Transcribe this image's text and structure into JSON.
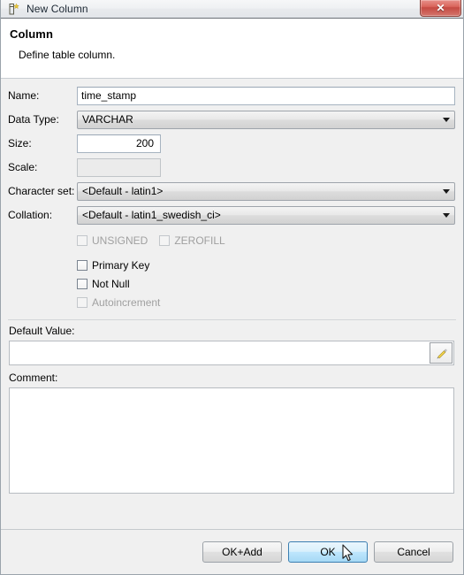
{
  "window": {
    "title": "New Column",
    "title_icon": "new-column-icon",
    "close_label": "✕"
  },
  "header": {
    "title": "Column",
    "subtitle": "Define table column."
  },
  "form": {
    "name": {
      "label": "Name:",
      "value": "time_stamp",
      "placeholder": ""
    },
    "data_type": {
      "label": "Data Type:",
      "value": "VARCHAR"
    },
    "size": {
      "label": "Size:",
      "value": "200"
    },
    "scale": {
      "label": "Scale:",
      "value": "",
      "disabled": true
    },
    "character_set": {
      "label": "Character set:",
      "value": "<Default - latin1>"
    },
    "collation": {
      "label": "Collation:",
      "value": "<Default - latin1_swedish_ci>"
    }
  },
  "checkboxes": {
    "unsigned": {
      "label": "UNSIGNED",
      "checked": false,
      "enabled": false
    },
    "zerofill": {
      "label": "ZEROFILL",
      "checked": false,
      "enabled": false
    },
    "primary_key": {
      "label": "Primary Key",
      "checked": false,
      "enabled": true
    },
    "not_null": {
      "label": "Not Null",
      "checked": false,
      "enabled": true
    },
    "autoincrement": {
      "label": "Autoincrement",
      "checked": false,
      "enabled": false
    }
  },
  "default_value": {
    "label": "Default Value:",
    "value": "",
    "edit_icon": "pencil-icon"
  },
  "comment": {
    "label": "Comment:",
    "value": ""
  },
  "buttons": {
    "ok_add": "OK+Add",
    "ok": "OK",
    "cancel": "Cancel"
  },
  "colors": {
    "dialog_bg": "#f0f0f0",
    "header_bg": "#ffffff",
    "close_red": "#c54a42",
    "hover_blue": "#bee6fd",
    "pencil_yellow": "#e8c83c",
    "disabled_text": "#a0a0a0"
  }
}
